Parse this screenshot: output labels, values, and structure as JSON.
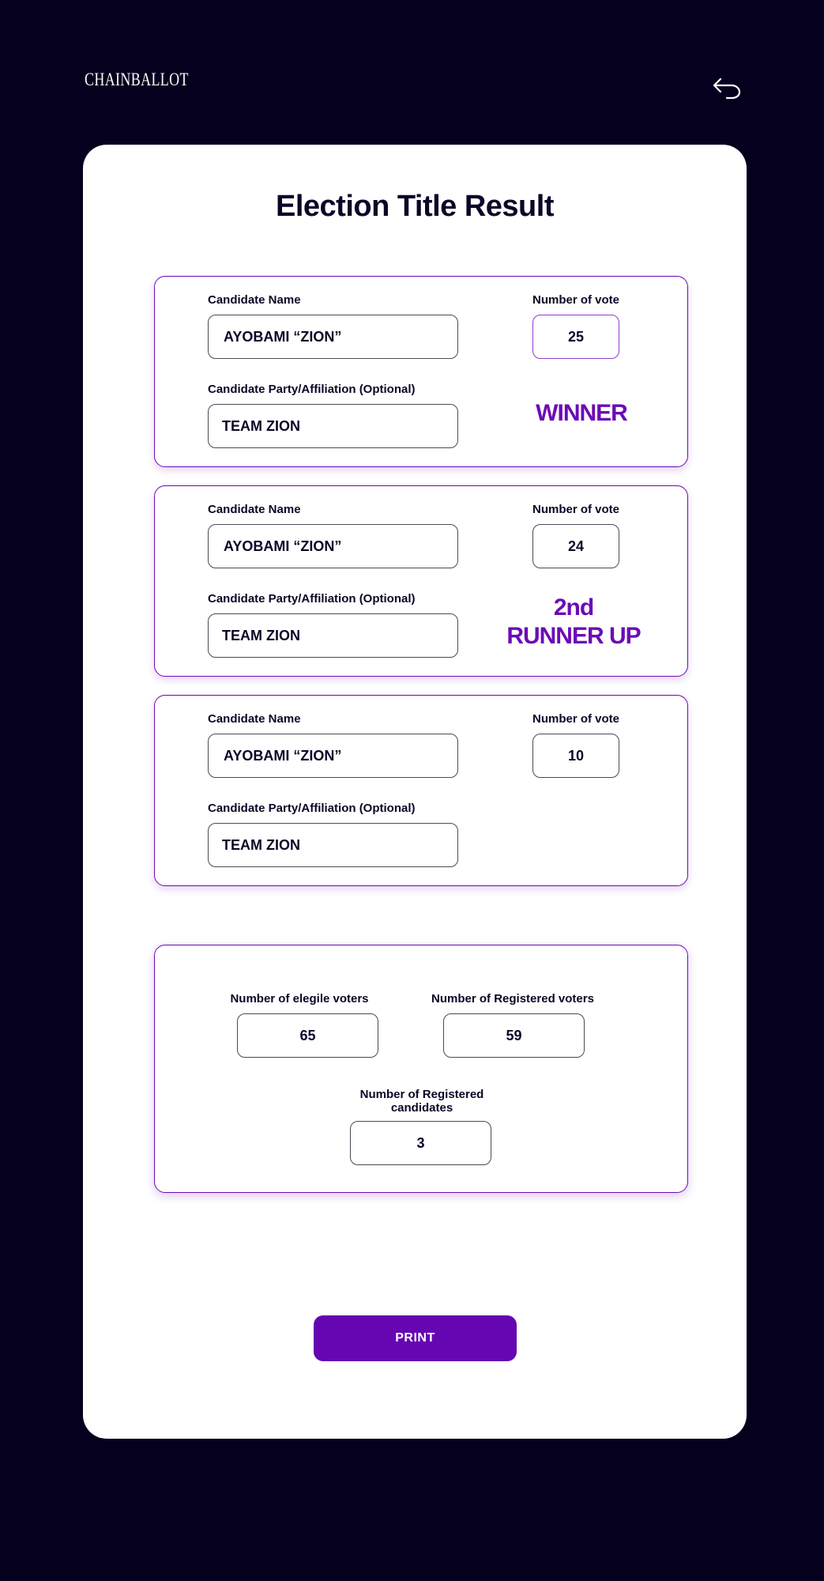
{
  "header": {
    "brand": "CHAINBALLOT",
    "back_icon": "undo-arrow-icon"
  },
  "page": {
    "title": "Election Title Result"
  },
  "labels": {
    "candidate_name": "Candidate Name",
    "party": "Candidate Party/Affiliation (Optional)",
    "votes": "Number of vote"
  },
  "candidates": [
    {
      "name": "AYOBAMI “ZION”",
      "party": "TEAM ZION",
      "votes": "25",
      "rank_line1": "WINNER",
      "rank_line2": ""
    },
    {
      "name": "AYOBAMI “ZION”",
      "party": "TEAM ZION",
      "votes": "24",
      "rank_line1": "2nd",
      "rank_line2": "RUNNER UP"
    },
    {
      "name": "AYOBAMI “ZION”",
      "party": "TEAM ZION",
      "votes": "10",
      "rank_line1": "",
      "rank_line2": ""
    }
  ],
  "stats": {
    "eligible_label": "Number of elegile voters",
    "eligible_value": "65",
    "registered_label": "Number of Registered voters",
    "registered_value": "59",
    "candidates_label_line1": "Number of Registered",
    "candidates_label_line2": "candidates",
    "candidates_value": "3"
  },
  "actions": {
    "print_label": "PRINT"
  },
  "colors": {
    "background": "#05001e",
    "accent": "#6606b3",
    "card": "#ffffff"
  }
}
